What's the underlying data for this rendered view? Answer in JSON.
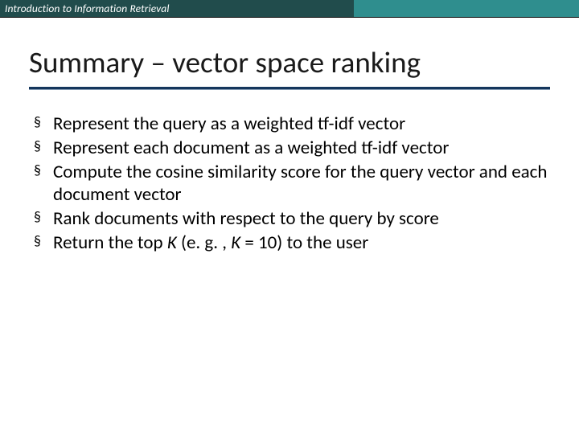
{
  "header": {
    "course_title": "Introduction to Information Retrieval"
  },
  "title": "Summary – vector space ranking",
  "bullets": [
    {
      "text": "Represent the query as a weighted tf-idf vector"
    },
    {
      "text": "Represent each document as a weighted tf-idf vector"
    },
    {
      "text": "Compute the cosine similarity score for the query vector and each document vector"
    },
    {
      "text": "Rank documents with respect to the query by score"
    },
    {
      "prefix": "Return the top ",
      "italic1": "K",
      "mid": " (e. g. , ",
      "italic2": "K",
      "suffix": " = 10) to the user"
    }
  ],
  "icons": {
    "bullet_marker": "§"
  }
}
